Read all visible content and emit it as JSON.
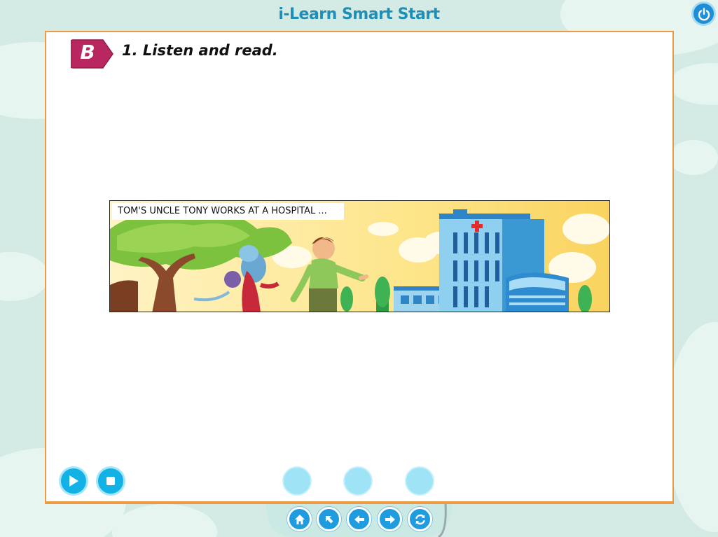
{
  "app": {
    "title": "i-Learn Smart Start"
  },
  "section": {
    "badge": "B",
    "instruction": "1. Listen and read."
  },
  "comic": {
    "caption": "TOM'S UNCLE TONY WORKS AT A HOSPITAL ..."
  },
  "colors": {
    "background": "#d3ebe4",
    "title": "#1f8fb8",
    "panel_border": "#ee9a45",
    "badge": "#b8275f",
    "control_button": "#12b2e6",
    "inactive_dot": "#9fe3f7",
    "nav_button": "#1f9be0"
  },
  "player_controls": [
    {
      "name": "play-button",
      "icon": "play-icon"
    },
    {
      "name": "stop-button",
      "icon": "stop-icon"
    }
  ],
  "page_dots": [
    {
      "name": "dot-button-1"
    },
    {
      "name": "dot-button-2"
    },
    {
      "name": "dot-button-3"
    }
  ],
  "nav": [
    {
      "name": "home-button",
      "icon": "home-icon"
    },
    {
      "name": "back-to-start-button",
      "icon": "arrow-up-left-icon"
    },
    {
      "name": "previous-button",
      "icon": "arrow-left-icon"
    },
    {
      "name": "next-button",
      "icon": "arrow-right-icon"
    },
    {
      "name": "replay-button",
      "icon": "refresh-icon"
    }
  ],
  "power": {
    "icon": "power-icon"
  }
}
